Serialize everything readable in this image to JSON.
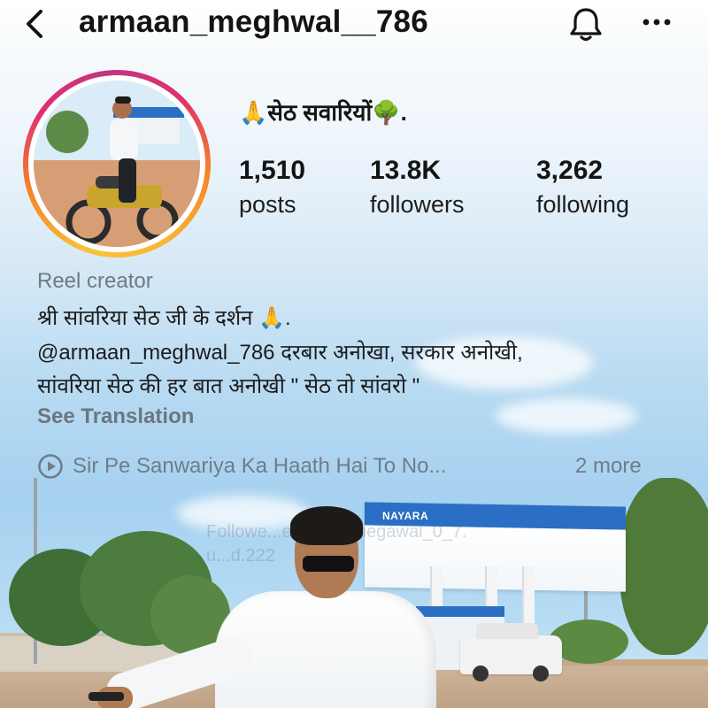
{
  "header": {
    "username": "armaan_meghwal__786"
  },
  "profile": {
    "display_name": "🙏सेठ सवारियों🌳.",
    "stats": [
      {
        "value": "1,510",
        "label": "posts"
      },
      {
        "value": "13.8K",
        "label": "followers"
      },
      {
        "value": "3,262",
        "label": "following"
      }
    ],
    "category": "Reel creator",
    "bio_lines": [
      "श्री सांवरिया सेठ जी के दर्शन 🙏.",
      "@armaan_meghwal_786 दरबार अनोखा, सरकार अनोखी,",
      "सांवरिया सेठ की हर बात अनोखी \" सेठ तो सांवरो \""
    ],
    "see_translation": "See Translation",
    "music": {
      "text": "Sir Pe Sanwariya Ka Haath Hai To No...",
      "more": "2 more"
    }
  },
  "background": {
    "canopy_brand": "NAYARA",
    "watermark": "Followe...ermaan_megawal_0_7.\nu...d.222"
  },
  "colors": {
    "text_primary": "#141414",
    "text_muted": "#6e7a84",
    "brand_blue": "#2a6fc4"
  }
}
